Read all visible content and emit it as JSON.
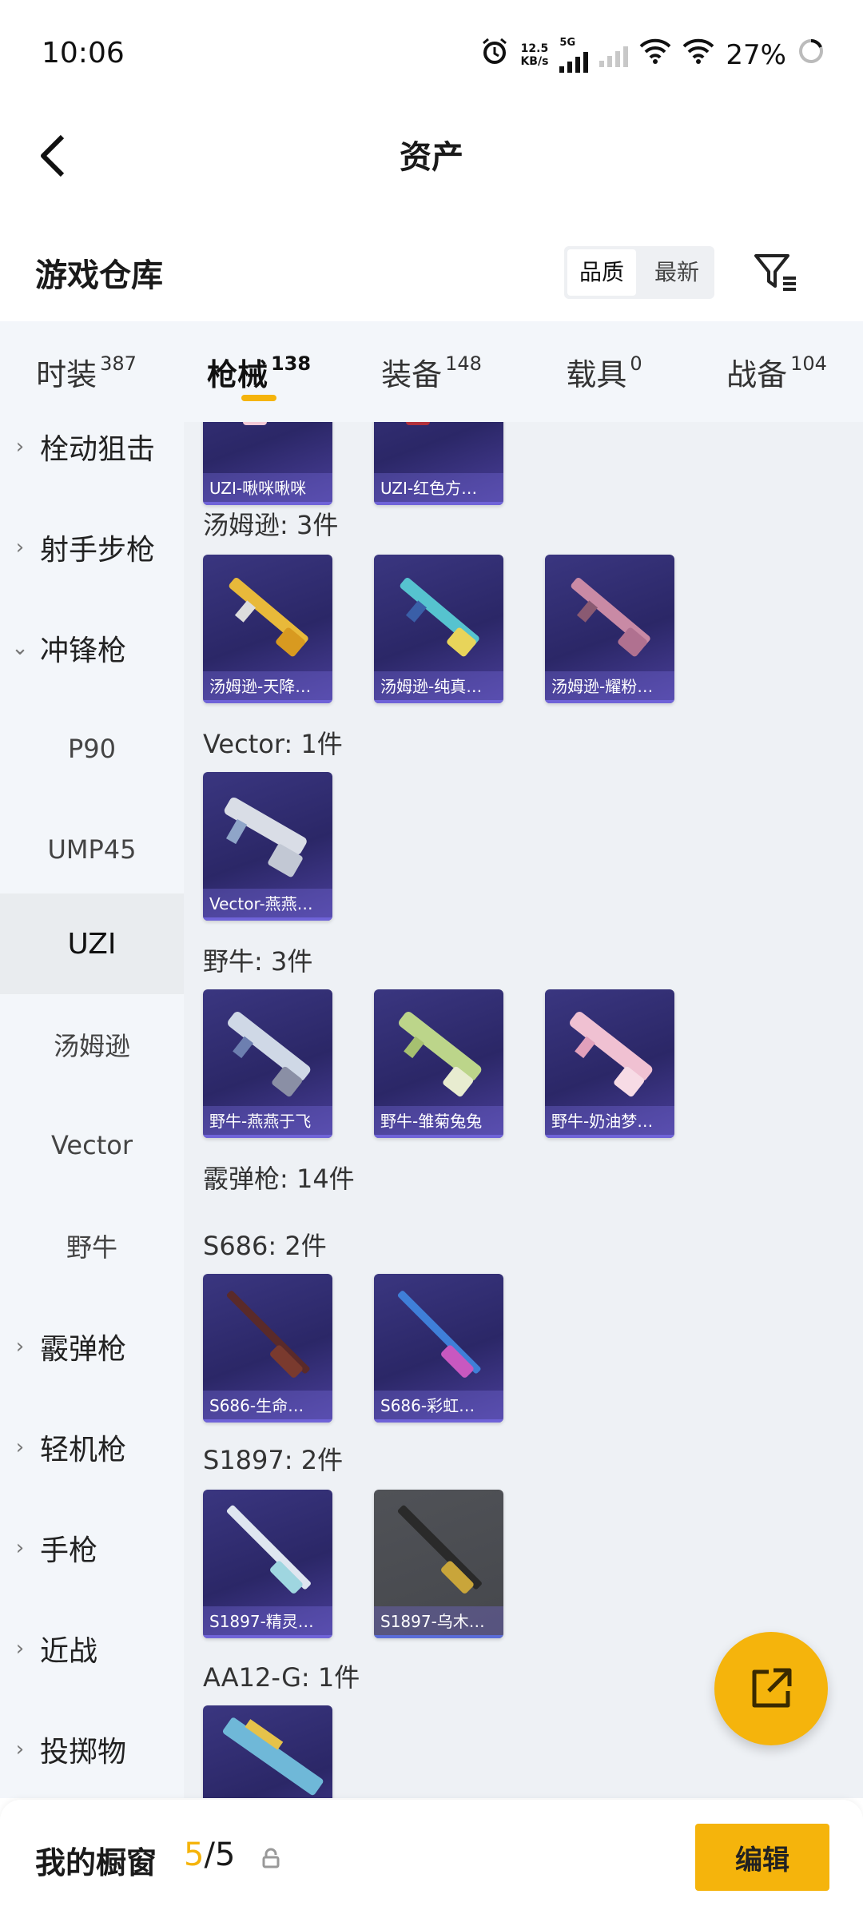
{
  "status": {
    "time": "10:06",
    "net_speed_top": "12.5",
    "net_speed_unit": "KB/s",
    "network_type": "5G",
    "battery": "27%"
  },
  "header": {
    "title": "资产"
  },
  "warehouse": {
    "label": "游戏仓库",
    "sort_options": [
      "品质",
      "最新"
    ],
    "sort_selected": "品质"
  },
  "tabs": [
    {
      "label": "时装",
      "count": "387"
    },
    {
      "label": "枪械",
      "count": "138",
      "active": true
    },
    {
      "label": "装备",
      "count": "148"
    },
    {
      "label": "载具",
      "count": "0"
    },
    {
      "label": "战备",
      "count": "104"
    }
  ],
  "sidebar": {
    "categories": [
      {
        "label": "栓动狙击"
      },
      {
        "label": "射手步枪"
      },
      {
        "label": "冲锋枪",
        "expanded": true
      },
      {
        "label": "霰弹枪"
      },
      {
        "label": "轻机枪"
      },
      {
        "label": "手枪"
      },
      {
        "label": "近战"
      },
      {
        "label": "投掷物"
      }
    ],
    "subs": [
      "P90",
      "UMP45",
      "UZI",
      "汤姆逊",
      "Vector",
      "野牛"
    ],
    "active_sub": "UZI"
  },
  "content": {
    "groups": [
      {
        "label": "",
        "items": [
          {
            "name": "UZI-啾咪啾咪"
          },
          {
            "name": "UZI-红色方…"
          }
        ]
      },
      {
        "label": "汤姆逊: 3件",
        "items": [
          {
            "name": "汤姆逊-天降…"
          },
          {
            "name": "汤姆逊-纯真…"
          },
          {
            "name": "汤姆逊-耀粉…"
          }
        ]
      },
      {
        "label": "Vector: 1件",
        "items": [
          {
            "name": "Vector-燕燕…"
          }
        ]
      },
      {
        "label": "野牛: 3件",
        "items": [
          {
            "name": "野牛-燕燕于飞"
          },
          {
            "name": "野牛-雏菊兔兔"
          },
          {
            "name": "野牛-奶油梦…"
          }
        ]
      },
      {
        "label": "霰弹枪: 14件",
        "items": []
      },
      {
        "label": "S686: 2件",
        "items": [
          {
            "name": "S686-生命…"
          },
          {
            "name": "S686-彩虹…"
          }
        ]
      },
      {
        "label": "S1897: 2件",
        "items": [
          {
            "name": "S1897-精灵…"
          },
          {
            "name": "S1897-乌木…"
          }
        ]
      },
      {
        "label": "AA12-G: 1件",
        "items": [
          {
            "name": ""
          }
        ]
      }
    ]
  },
  "bottom": {
    "label": "我的橱窗",
    "current": "5",
    "separator": "/",
    "total": "5",
    "edit": "编辑"
  },
  "icons": {
    "back": "chevron-left-icon",
    "filter": "filter-icon",
    "share": "external-link-icon",
    "lock": "lock-icon"
  },
  "colors": {
    "accent": "#f5b40c",
    "card_bg": "#2b2767",
    "card_grey": "#45474c"
  }
}
